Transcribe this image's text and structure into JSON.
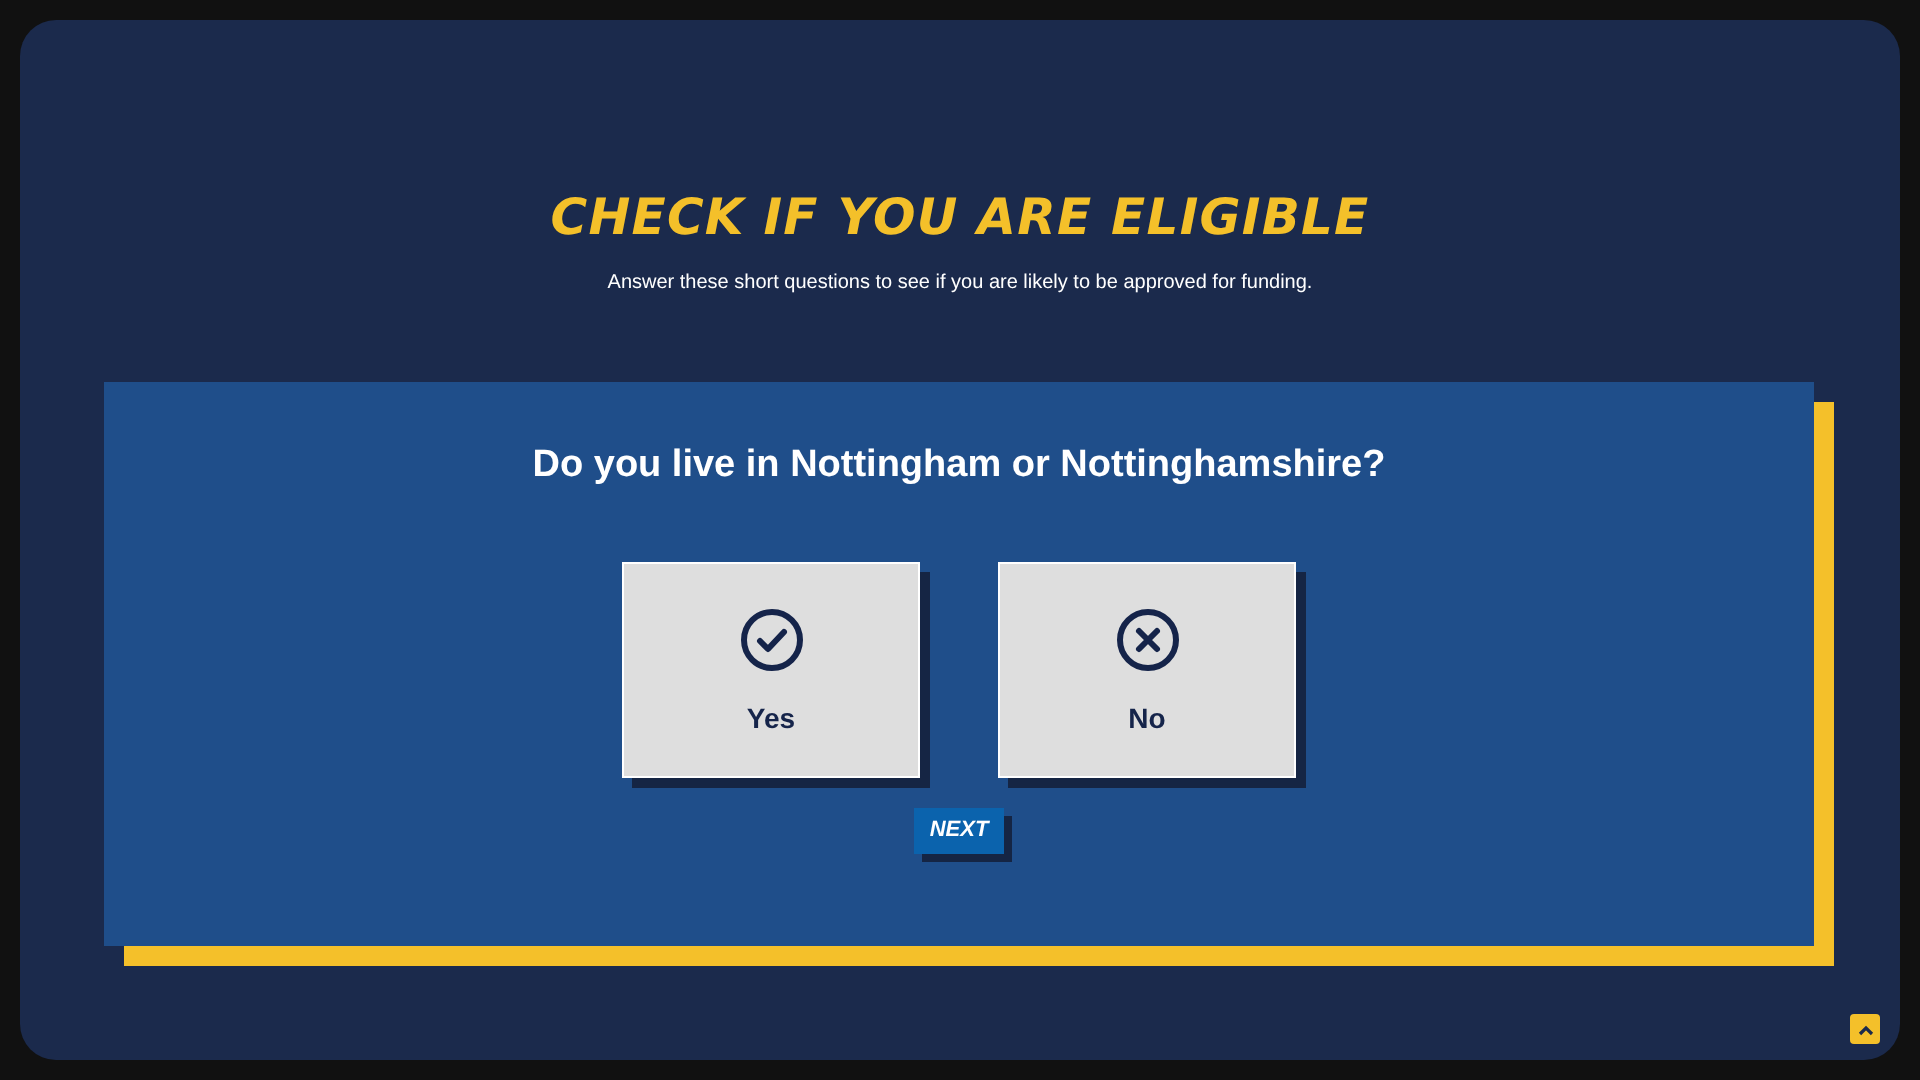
{
  "title": "CHECK IF YOU ARE ELIGIBLE",
  "subtitle": "Answer these short questions to see if you are likely to be approved for funding.",
  "question": "Do you live in Nottingham or Nottinghamshire?",
  "options": [
    {
      "kind": "yes",
      "label": "Yes",
      "selected": false
    },
    {
      "kind": "no",
      "label": "No",
      "selected": false
    }
  ],
  "next_button": "NEXT"
}
